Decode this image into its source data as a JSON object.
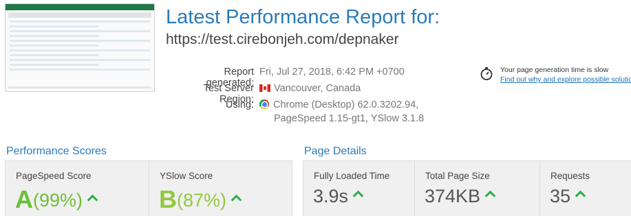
{
  "report": {
    "title": "Latest Performance Report for:",
    "url": "https://test.cirebonjeh.com/depnaker",
    "generated_label": "Report generated:",
    "generated_value": "Fri, Jul 27, 2018, 6:42 PM +0700",
    "region_label": "Test Server Region:",
    "region_value": "Vancouver, Canada",
    "using_label": "Using:",
    "using_line1": "Chrome (Desktop) 62.0.3202.94,",
    "using_line2": "PageSpeed 1.15-gt1, YSlow 3.1.8"
  },
  "notice": {
    "text": "Your page generation time is slow",
    "link": "Find out why and explore possible solutions »"
  },
  "performance": {
    "heading": "Performance Scores",
    "pagespeed": {
      "label": "PageSpeed Score",
      "grade": "A",
      "percent": "(99%)",
      "color": "#6cbf3a"
    },
    "yslow": {
      "label": "YSlow Score",
      "grade": "B",
      "percent": "(87%)",
      "color": "#93c83e"
    }
  },
  "details": {
    "heading": "Page Details",
    "load_time": {
      "label": "Fully Loaded Time",
      "value": "3.9s"
    },
    "page_size": {
      "label": "Total Page Size",
      "value": "374KB"
    },
    "requests": {
      "label": "Requests",
      "value": "35"
    }
  },
  "icons": [
    "stopwatch-icon",
    "canada-flag-icon",
    "chrome-icon",
    "arrow-up-icon"
  ]
}
